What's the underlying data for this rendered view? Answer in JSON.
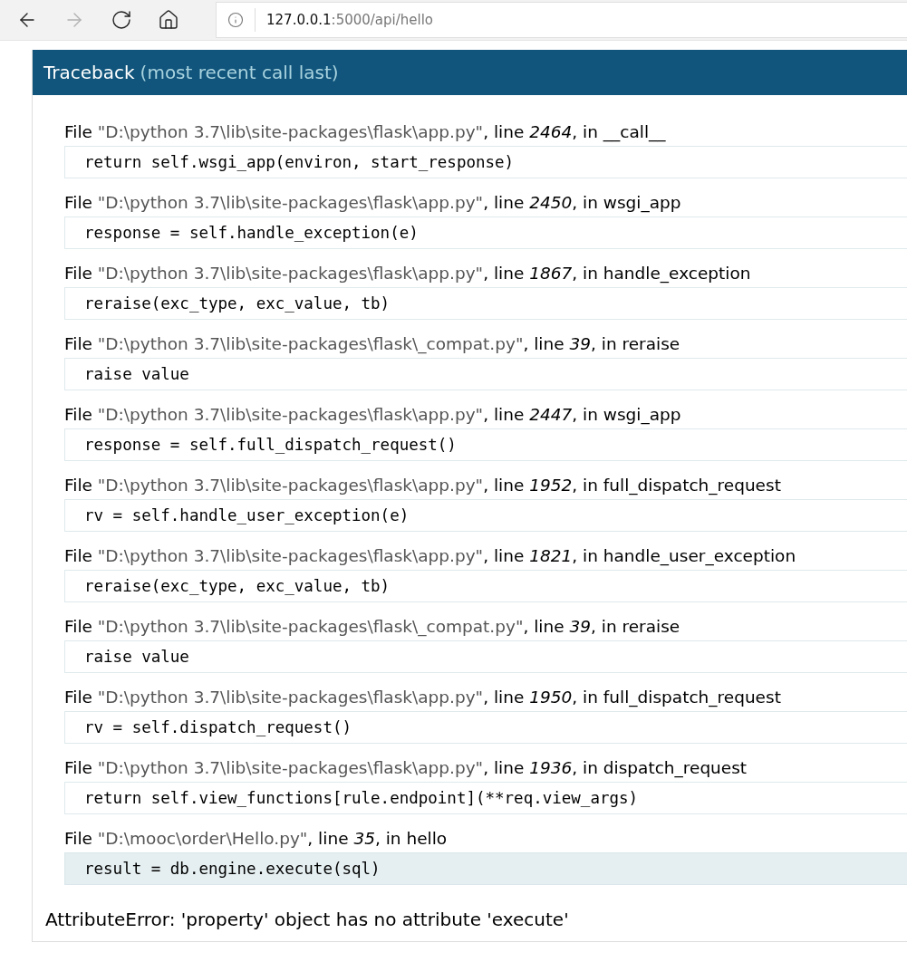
{
  "browser": {
    "nav_buttons": [
      {
        "kind": "back",
        "disabled": false
      },
      {
        "kind": "forward",
        "disabled": true
      },
      {
        "kind": "reload",
        "disabled": false
      },
      {
        "kind": "home",
        "disabled": false
      }
    ],
    "address": {
      "host": "127.0.0.1",
      "path": ":5000/api/hello"
    }
  },
  "traceback": {
    "title": "Traceback",
    "subtitle": "(most recent call last)",
    "frames": [
      {
        "file_label": "File",
        "file": "\"D:\\python 3.7\\lib\\site-packages\\flask\\app.py\"",
        "line_label": ", line",
        "line": "2464",
        "function_label": ", in",
        "function": "__call__",
        "code": "return self.wsgi_app(environ, start_response)",
        "current": false
      },
      {
        "file_label": "File",
        "file": "\"D:\\python 3.7\\lib\\site-packages\\flask\\app.py\"",
        "line_label": ", line",
        "line": "2450",
        "function_label": ", in",
        "function": "wsgi_app",
        "code": "response = self.handle_exception(e)",
        "current": false
      },
      {
        "file_label": "File",
        "file": "\"D:\\python 3.7\\lib\\site-packages\\flask\\app.py\"",
        "line_label": ", line",
        "line": "1867",
        "function_label": ", in",
        "function": "handle_exception",
        "code": "reraise(exc_type, exc_value, tb)",
        "current": false
      },
      {
        "file_label": "File",
        "file": "\"D:\\python 3.7\\lib\\site-packages\\flask\\_compat.py\"",
        "line_label": ", line",
        "line": "39",
        "function_label": ", in",
        "function": "reraise",
        "code": "raise value",
        "current": false
      },
      {
        "file_label": "File",
        "file": "\"D:\\python 3.7\\lib\\site-packages\\flask\\app.py\"",
        "line_label": ", line",
        "line": "2447",
        "function_label": ", in",
        "function": "wsgi_app",
        "code": "response = self.full_dispatch_request()",
        "current": false
      },
      {
        "file_label": "File",
        "file": "\"D:\\python 3.7\\lib\\site-packages\\flask\\app.py\"",
        "line_label": ", line",
        "line": "1952",
        "function_label": ", in",
        "function": "full_dispatch_request",
        "code": "rv = self.handle_user_exception(e)",
        "current": false
      },
      {
        "file_label": "File",
        "file": "\"D:\\python 3.7\\lib\\site-packages\\flask\\app.py\"",
        "line_label": ", line",
        "line": "1821",
        "function_label": ", in",
        "function": "handle_user_exception",
        "code": "reraise(exc_type, exc_value, tb)",
        "current": false
      },
      {
        "file_label": "File",
        "file": "\"D:\\python 3.7\\lib\\site-packages\\flask\\_compat.py\"",
        "line_label": ", line",
        "line": "39",
        "function_label": ", in",
        "function": "reraise",
        "code": "raise value",
        "current": false
      },
      {
        "file_label": "File",
        "file": "\"D:\\python 3.7\\lib\\site-packages\\flask\\app.py\"",
        "line_label": ", line",
        "line": "1950",
        "function_label": ", in",
        "function": "full_dispatch_request",
        "code": "rv = self.dispatch_request()",
        "current": false
      },
      {
        "file_label": "File",
        "file": "\"D:\\python 3.7\\lib\\site-packages\\flask\\app.py\"",
        "line_label": ", line",
        "line": "1936",
        "function_label": ", in",
        "function": "dispatch_request",
        "code": "return self.view_functions[rule.endpoint](**req.view_args)",
        "current": false
      },
      {
        "file_label": "File",
        "file": "\"D:\\mooc\\order\\Hello.py\"",
        "line_label": ", line",
        "line": "35",
        "function_label": ", in",
        "function": "hello",
        "code": "result = db.engine.execute(sql)",
        "current": true
      }
    ],
    "error": {
      "type": "AttributeError",
      "message": ": 'property' object has no attribute 'execute'"
    }
  }
}
